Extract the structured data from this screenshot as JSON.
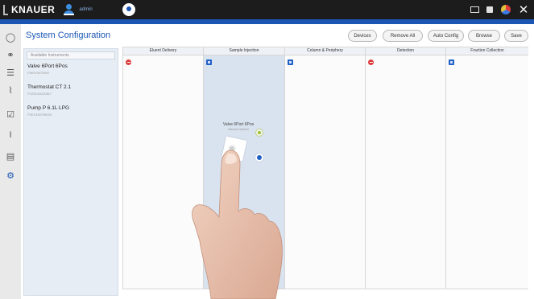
{
  "app": {
    "brand": "KNAUER",
    "user": "admin",
    "title": "System Configuration"
  },
  "toolbar": {
    "devices": "Devices",
    "remove_all": "Remove All",
    "auto_config": "Auto Config",
    "browse": "Browse",
    "save": "Save"
  },
  "available": {
    "header": "Available Instruments",
    "instruments": [
      {
        "name": "Valve 6Port 6Pos",
        "serial": "FWH19470000"
      },
      {
        "name": "Thermostat CT 2.1",
        "serial": "FCE2018100817"
      },
      {
        "name": "Pump P 6.1L LPG",
        "serial": "FSE1335708003"
      }
    ]
  },
  "columns": [
    {
      "label": "Eluent Delivery",
      "badge": "red"
    },
    {
      "label": "Sample Injection",
      "badge": "blue",
      "highlighted": true
    },
    {
      "label": "Column & Periphery",
      "badge": "blue"
    },
    {
      "label": "Detection",
      "badge": "red"
    },
    {
      "label": "Fraction Collection",
      "badge": "blue"
    }
  ],
  "device": {
    "name": "Valve 6Port 6Pos",
    "subtitle": "Manual installed"
  },
  "colors": {
    "accent": "#1b56b4",
    "topbar": "#1c1c1c",
    "highlight_column": "#d9e2ef",
    "error_badge": "#e03b3b"
  }
}
